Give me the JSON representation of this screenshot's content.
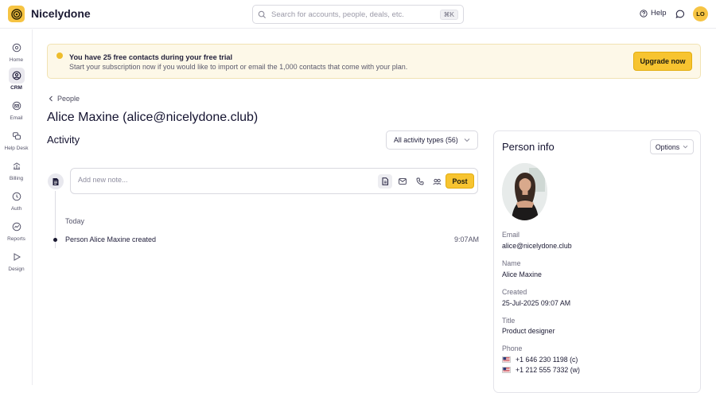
{
  "app": {
    "name": "Nicelydone"
  },
  "search": {
    "placeholder": "Search for accounts, people, deals, etc.",
    "shortcut": "⌘K"
  },
  "topbar": {
    "help_label": "Help",
    "user_initials": "LO"
  },
  "sidebar": {
    "items": [
      {
        "label": "Home",
        "icon": "home-icon",
        "active": false
      },
      {
        "label": "CRM",
        "icon": "crm-icon",
        "active": true
      },
      {
        "label": "Email",
        "icon": "email-icon",
        "active": false
      },
      {
        "label": "Help Desk",
        "icon": "help-desk-icon",
        "active": false
      },
      {
        "label": "Billing",
        "icon": "billing-icon",
        "active": false
      },
      {
        "label": "Auth",
        "icon": "auth-icon",
        "active": false
      },
      {
        "label": "Reports",
        "icon": "reports-icon",
        "active": false
      },
      {
        "label": "Design",
        "icon": "design-icon",
        "active": false
      }
    ]
  },
  "banner": {
    "title": "You have 25 free contacts during your free trial",
    "subtitle": "Start your subscription now if you would like to import or email the 1,000 contacts that come with your plan.",
    "cta_label": "Upgrade now"
  },
  "breadcrumb": {
    "label": "People"
  },
  "page": {
    "title": "Alice Maxine (alice@nicelydone.club)"
  },
  "activity": {
    "heading": "Activity",
    "filter_label": "All activity types (56)",
    "note_placeholder": "Add new note...",
    "post_label": "Post",
    "group_label": "Today",
    "events": [
      {
        "text": "Person Alice Maxine created",
        "time": "9:07AM"
      }
    ]
  },
  "person_info": {
    "title": "Person info",
    "options_label": "Options",
    "fields": {
      "email_label": "Email",
      "email_value": "alice@nicelydone.club",
      "name_label": "Name",
      "name_value": "Alice Maxine",
      "created_label": "Created",
      "created_value": "25-Jul-2025 09:07 AM",
      "title_label": "Title",
      "title_value": "Product designer",
      "phone_label": "Phone"
    },
    "phones": [
      {
        "number": "+1 646 230 1198 (c)",
        "flag": "us-flag-icon"
      },
      {
        "number": "+1 212 555 7332 (w)",
        "flag": "us-flag-icon"
      }
    ]
  },
  "colors": {
    "accent": "#f7c430",
    "banner_bg": "#fdf8e8",
    "text_dark": "#141330"
  }
}
